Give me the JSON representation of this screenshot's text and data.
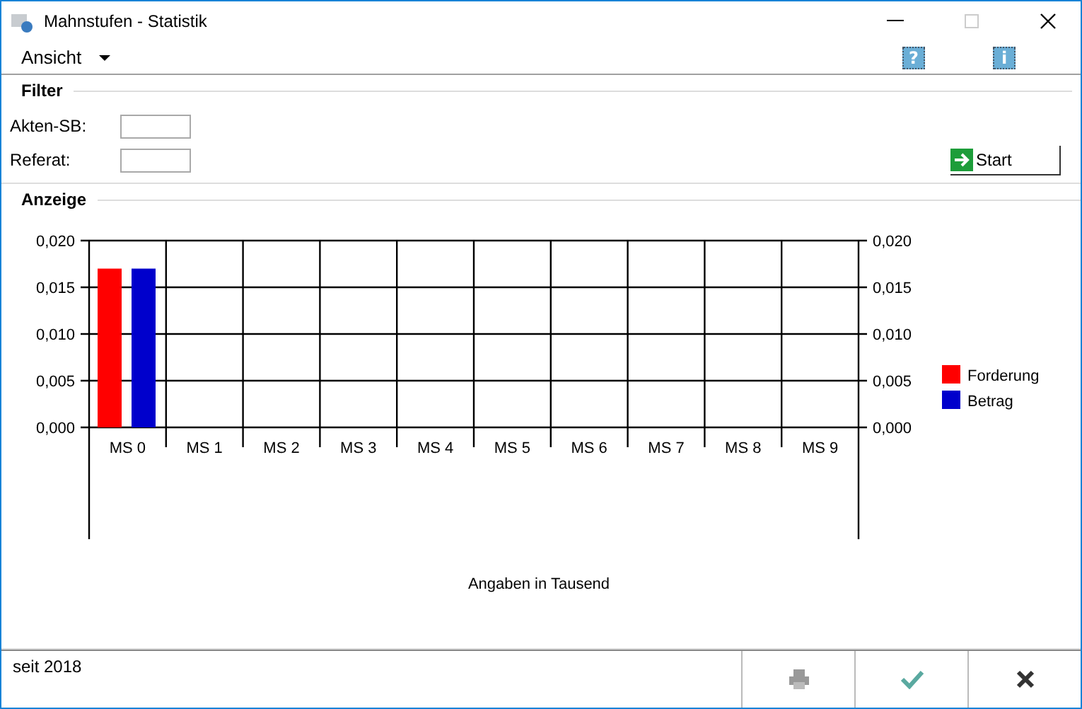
{
  "window": {
    "title": "Mahnstufen - Statistik"
  },
  "menu": {
    "label": "Ansicht",
    "help_button": "?",
    "info_button": "i"
  },
  "filter": {
    "title": "Filter",
    "fields": [
      {
        "label": "Akten-SB:"
      },
      {
        "label": "Referat:"
      }
    ],
    "start_button": "Start"
  },
  "display": {
    "title": "Anzeige",
    "chart_data": {
      "type": "bar",
      "categories": [
        "MS 0",
        "MS 1",
        "MS 2",
        "MS 3",
        "MS 4",
        "MS 5",
        "MS 6",
        "MS 7",
        "MS 8",
        "MS 9"
      ],
      "series": [
        {
          "name": "Forderung",
          "color": "#ff0000",
          "values": [
            0.017,
            0,
            0,
            0,
            0,
            0,
            0,
            0,
            0,
            0
          ]
        },
        {
          "name": "Betrag",
          "color": "#0000cc",
          "values": [
            0.017,
            0,
            0,
            0,
            0,
            0,
            0,
            0,
            0,
            0
          ]
        }
      ],
      "ylim": [
        0,
        0.02
      ],
      "yticks": [
        {
          "value": 0,
          "label": "0,000"
        },
        {
          "value": 0.005,
          "label": "0,005"
        },
        {
          "value": 0.01,
          "label": "0,010"
        },
        {
          "value": 0.015,
          "label": "0,015"
        },
        {
          "value": 0.02,
          "label": "0,020"
        }
      ],
      "grid": true,
      "legend": true,
      "annotations": [
        {
          "text": "Angaben in Tausend"
        }
      ]
    }
  },
  "status_bar": {
    "text": "seit 2018"
  }
}
